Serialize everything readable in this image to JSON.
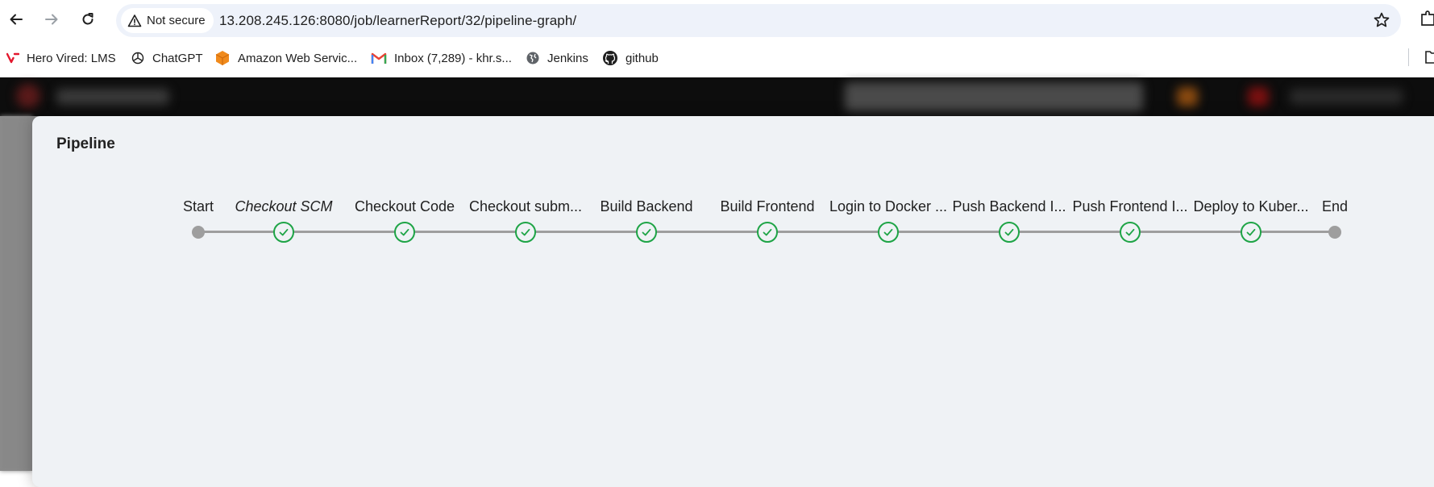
{
  "browser": {
    "security_label": "Not secure",
    "url": "13.208.245.126:8080/job/learnerReport/32/pipeline-graph/",
    "icons": [
      "back-arrow-icon",
      "forward-arrow-icon",
      "reload-icon",
      "warning-icon",
      "star-icon",
      "extensions-icon"
    ]
  },
  "bookmarks": [
    {
      "label": "Hero Vired: LMS",
      "icon": "hero-vired-icon"
    },
    {
      "label": "ChatGPT",
      "icon": "chatgpt-icon"
    },
    {
      "label": "Amazon Web Servic...",
      "icon": "aws-icon"
    },
    {
      "label": "Inbox (7,289) - khr.s...",
      "icon": "gmail-icon"
    },
    {
      "label": "Jenkins",
      "icon": "globe-icon"
    },
    {
      "label": "github",
      "icon": "github-icon"
    }
  ],
  "pipeline": {
    "title": "Pipeline",
    "start_label": "Start",
    "end_label": "End",
    "stages": [
      {
        "label": "Checkout SCM",
        "status": "success",
        "italic": true
      },
      {
        "label": "Checkout Code",
        "status": "success"
      },
      {
        "label": "Checkout subm...",
        "status": "success"
      },
      {
        "label": "Build Backend",
        "status": "success"
      },
      {
        "label": "Build Frontend",
        "status": "success"
      },
      {
        "label": "Login to Docker ...",
        "status": "success"
      },
      {
        "label": "Push Backend I...",
        "status": "success"
      },
      {
        "label": "Push Frontend I...",
        "status": "success"
      },
      {
        "label": "Deploy to Kuber...",
        "status": "success"
      }
    ]
  },
  "colors": {
    "success": "#1ea446",
    "connector": "#9e9e9e",
    "modal_bg": "#eff2f5"
  }
}
